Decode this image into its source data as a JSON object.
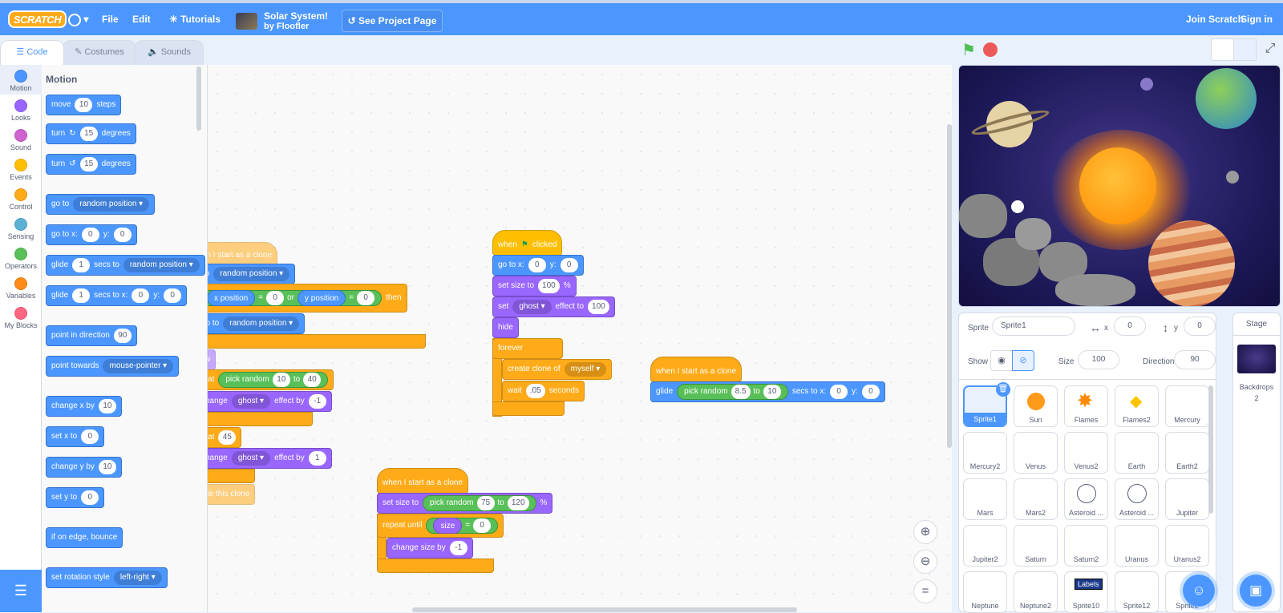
{
  "menubar": {
    "logo": "SCRATCH",
    "globe": "▾",
    "file": "File",
    "edit": "Edit",
    "tutorials": "Tutorials",
    "project_title": "Solar System!",
    "project_author": "by Floofler",
    "see_project": "See Project Page",
    "join": "Join Scratch",
    "signin": "Sign in"
  },
  "tabs": {
    "code": "Code",
    "costumes": "Costumes",
    "sounds": "Sounds"
  },
  "categories": [
    {
      "label": "Motion",
      "color": "#4c97ff"
    },
    {
      "label": "Looks",
      "color": "#9966ff"
    },
    {
      "label": "Sound",
      "color": "#cf63cf"
    },
    {
      "label": "Events",
      "color": "#ffbf00"
    },
    {
      "label": "Control",
      "color": "#ffab19"
    },
    {
      "label": "Sensing",
      "color": "#5cb1d6"
    },
    {
      "label": "Operators",
      "color": "#59c059"
    },
    {
      "label": "Variables",
      "color": "#ff8c1a"
    },
    {
      "label": "My Blocks",
      "color": "#ff6680"
    }
  ],
  "palette": {
    "heading": "Motion",
    "b_move": "move",
    "b_move_v": "10",
    "b_move_u": "steps",
    "b_turn": "turn",
    "b_turn_v": "15",
    "b_deg": "degrees",
    "b_goto": "go to",
    "b_random": "random position",
    "b_gotoxy": "go to x:",
    "b_x0": "0",
    "b_y": "y:",
    "b_y0": "0",
    "b_glide": "glide",
    "b_one": "1",
    "b_secs_to": "secs to",
    "b_secs_tox": "secs to x:",
    "b_point_dir": "point in direction",
    "b_90": "90",
    "b_point_tow": "point towards",
    "b_mouse": "mouse-pointer",
    "b_chx": "change x by",
    "b_10": "10",
    "b_setx": "set x to",
    "b_chy": "change y by",
    "b_sety": "set y to",
    "b_bounce": "if on edge, bounce",
    "b_rot": "set rotation style",
    "b_lr": "left-right"
  },
  "script1": {
    "hat": "when I start as a clone",
    "goto": "go to",
    "rp": "random position",
    "if": "if",
    "xpos": "x position",
    "eq": "=",
    "z": "0",
    "or": "or",
    "ypos": "y position",
    "then": "then",
    "show": "show",
    "repeat": "repeat",
    "pickr": "pick random",
    "r10": "10",
    "to": "to",
    "r40": "40",
    "change": "change",
    "ghost": "ghost",
    "effby": "effect by",
    "m1": "-1",
    "r45": "45",
    "one": "1",
    "del": "delete this clone"
  },
  "script2": {
    "hat": "when",
    "clicked": "clicked",
    "gotox": "go to x:",
    "z": "0",
    "y": "y:",
    "setsize": "set size to",
    "h100": "100",
    "pct": "%",
    "set": "set",
    "ghost": "ghost",
    "effto": "effect to",
    "hide": "hide",
    "forever": "forever",
    "create": "create clone of",
    "myself": "myself",
    "wait": "wait",
    "w05": ".05",
    "secs": "seconds"
  },
  "script3": {
    "hat": "when I start as a clone",
    "setsize": "set size to",
    "pickr": "pick random",
    "r75": "75",
    "to": "to",
    "r120": "120",
    "pct": "%",
    "repeat_until": "repeat until",
    "size": "size",
    "eq": "=",
    "z": "0",
    "chsize": "change size by",
    "m1": "-1"
  },
  "script4": {
    "hat": "when I start as a clone",
    "glide": "glide",
    "pickr": "pick random",
    "r85": "8.5",
    "to": "to",
    "r10": "10",
    "secs": "secs to x:",
    "z": "0",
    "y": "y:"
  },
  "sprite_info": {
    "sprite_label": "Sprite",
    "sprite_name": "Sprite1",
    "x_label": "x",
    "x": "0",
    "y_label": "y",
    "y": "0",
    "show_label": "Show",
    "size_label": "Size",
    "size": "100",
    "dir_label": "Direction",
    "dir": "90"
  },
  "sprites": [
    "Sprite1",
    "Sun",
    "Flames",
    "Flames2",
    "Mercury",
    "Mercury2",
    "Venus",
    "Venus2",
    "Earth",
    "Earth2",
    "Mars",
    "Mars2",
    "Asteroid ...",
    "Asteroid ...",
    "Jupiter",
    "Jupiter2",
    "Saturn",
    "Saturn2",
    "Uranus",
    "Uranus2",
    "Neptune",
    "Neptune2",
    "Sprite10",
    "Sprite12",
    "Sprite2"
  ],
  "stage_panel": {
    "title": "Stage",
    "backdrops_label": "Backdrops",
    "backdrops_count": "2"
  },
  "labels_thumb": "Labels"
}
